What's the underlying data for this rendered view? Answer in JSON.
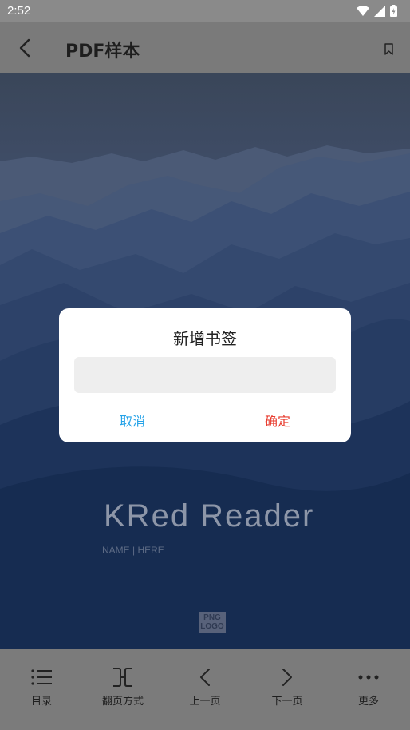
{
  "status_bar": {
    "time": "2:52"
  },
  "app_bar": {
    "title": "PDF样本"
  },
  "cover": {
    "title": "KRed Reader",
    "subtitle": "NAME | HERE",
    "logo_line1": "PNG",
    "logo_line2": "LOGO"
  },
  "dialog": {
    "title": "新增书签",
    "input_value": "",
    "cancel_label": "取消",
    "confirm_label": "确定"
  },
  "bottom_nav": {
    "items": [
      {
        "label": "目录",
        "icon": "list-icon"
      },
      {
        "label": "翻页方式",
        "icon": "page-turn-icon"
      },
      {
        "label": "上一页",
        "icon": "chevron-left-icon"
      },
      {
        "label": "下一页",
        "icon": "chevron-right-icon"
      },
      {
        "label": "更多",
        "icon": "more-icon"
      }
    ]
  },
  "colors": {
    "cancel": "#26a3e8",
    "confirm": "#e83b2e",
    "bars": "#7b7b7b"
  }
}
